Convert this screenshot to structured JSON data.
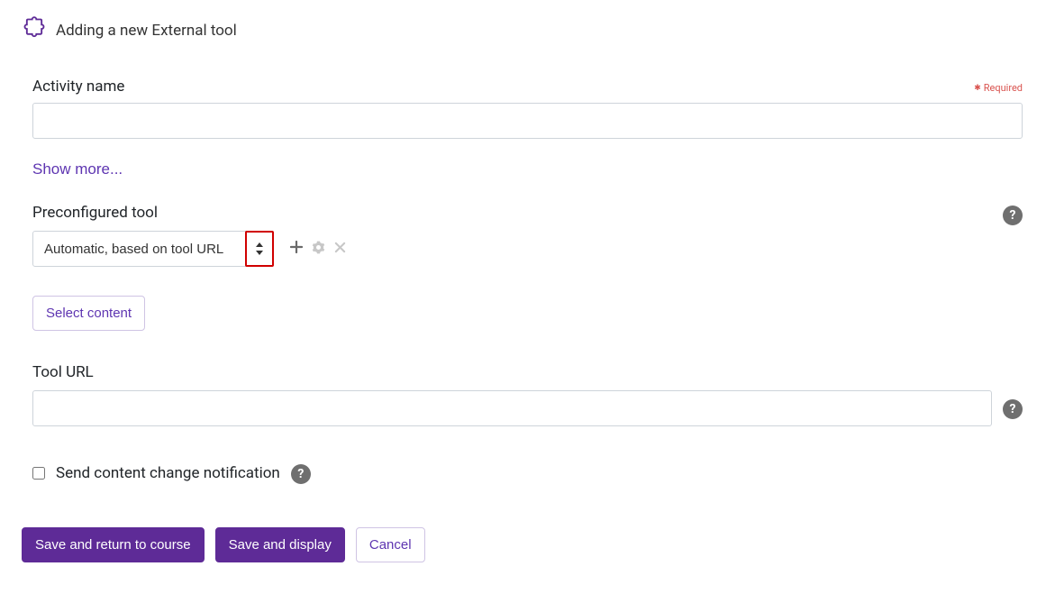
{
  "header": {
    "title": "Adding a new External tool"
  },
  "form": {
    "activity_name_label": "Activity name",
    "activity_name_value": "",
    "required_label": "Required",
    "show_more_label": "Show more...",
    "preconfigured_tool_label": "Preconfigured tool",
    "preconfigured_tool_selected": "Automatic, based on tool URL",
    "select_content_label": "Select content",
    "tool_url_label": "Tool URL",
    "tool_url_value": "",
    "send_notification_label": "Send content change notification",
    "send_notification_checked": false
  },
  "actions": {
    "save_return_label": "Save and return to course",
    "save_display_label": "Save and display",
    "cancel_label": "Cancel"
  },
  "help_text": "?"
}
